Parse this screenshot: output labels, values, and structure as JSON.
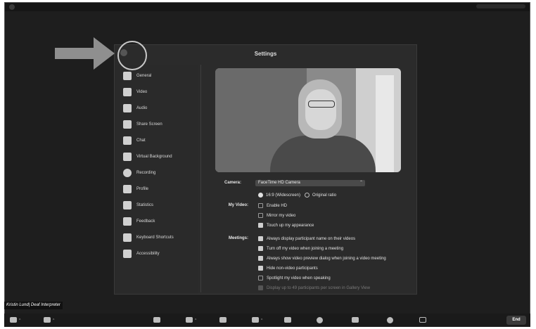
{
  "settings": {
    "title": "Settings",
    "sidebar": [
      {
        "label": "General",
        "icon": "gear-icon"
      },
      {
        "label": "Video",
        "icon": "video-camera-icon"
      },
      {
        "label": "Audio",
        "icon": "headphones-icon"
      },
      {
        "label": "Share Screen",
        "icon": "share-screen-icon"
      },
      {
        "label": "Chat",
        "icon": "chat-bubble-icon"
      },
      {
        "label": "Virtual Background",
        "icon": "person-background-icon"
      },
      {
        "label": "Recording",
        "icon": "record-icon"
      },
      {
        "label": "Profile",
        "icon": "profile-icon"
      },
      {
        "label": "Statistics",
        "icon": "bar-chart-icon"
      },
      {
        "label": "Feedback",
        "icon": "feedback-icon"
      },
      {
        "label": "Keyboard Shortcuts",
        "icon": "keyboard-icon"
      },
      {
        "label": "Accessibility",
        "icon": "accessibility-icon"
      }
    ],
    "camera": {
      "label": "Camera:",
      "value": "FaceTime HD Camera"
    },
    "my_video": {
      "label": "My Video:",
      "ratio_widescreen": "16:9 (Widescreen)",
      "ratio_original": "Original ratio",
      "enable_hd": "Enable HD",
      "mirror": "Mirror my video",
      "touch_up": "Touch up my appearance"
    },
    "meetings": {
      "label": "Meetings:",
      "always_display_name": "Always display participant name on their videos",
      "turn_off_video": "Turn off my video when joining a meeting",
      "always_show_preview": "Always show video preview dialog when joining a video meeting",
      "hide_non_video": "Hide non-video participants",
      "spotlight": "Spotlight my video when speaking",
      "display_49": "Display up to 49 participants per screen in Gallery View"
    }
  },
  "name_tag": "Kristin Lund| Deaf Interpreter",
  "toolbar": {
    "end_label": "End"
  },
  "colors": {
    "background": "#1e1e1e",
    "panel": "#2b2b2b",
    "annotation": "#8f8f8f"
  }
}
